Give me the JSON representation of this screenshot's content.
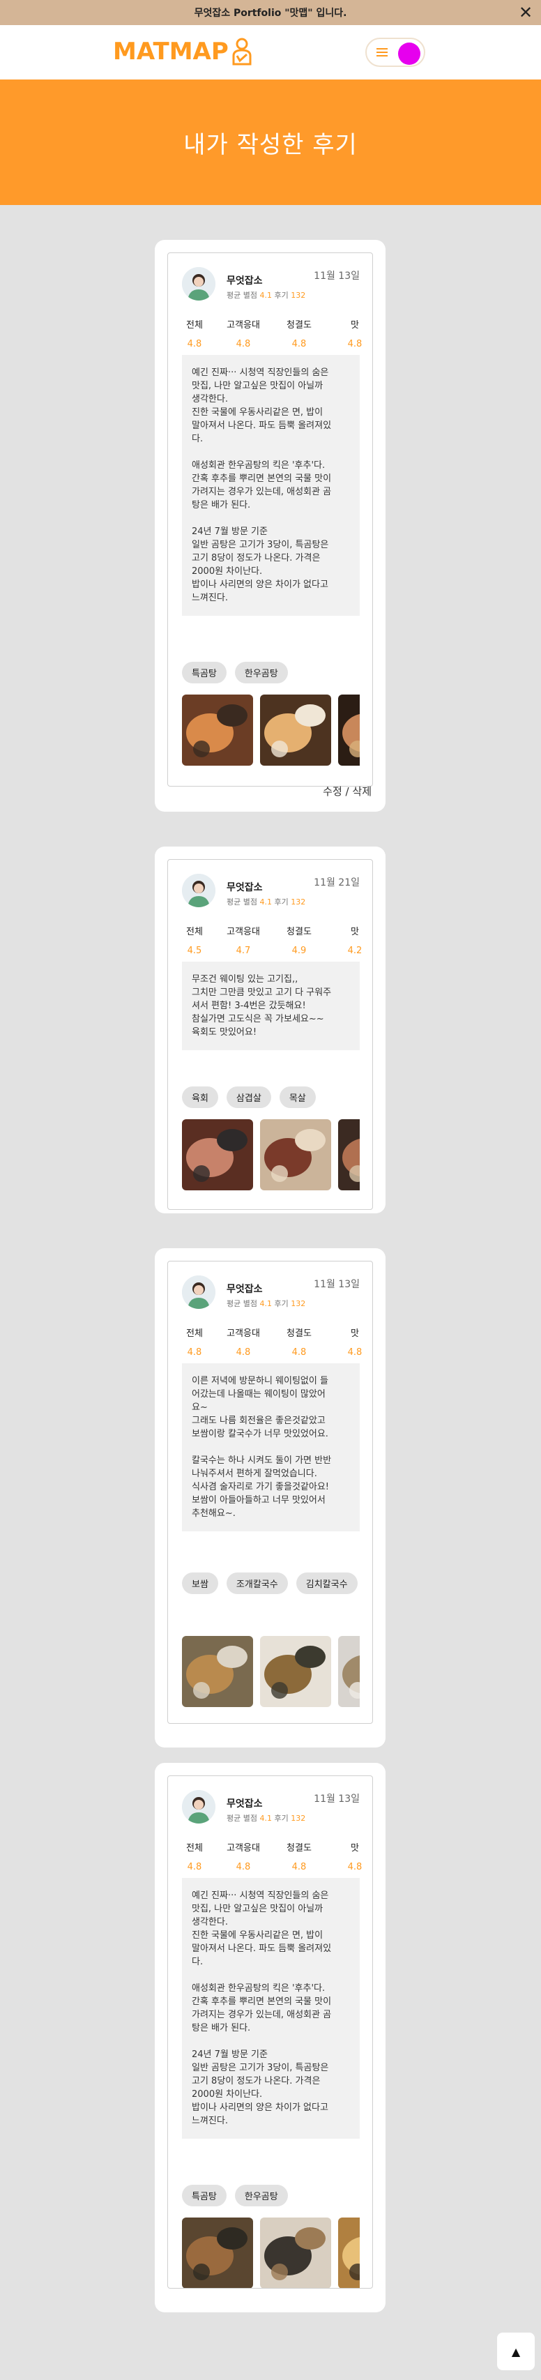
{
  "notice": {
    "text": "무엇잡소 Portfolio \"맛맵\" 입니다.",
    "close": "✕"
  },
  "header": {
    "logo": "MATMAP"
  },
  "banner": {
    "title": "내가 작성한 후기"
  },
  "colors": {
    "accent": "#ff9a1f",
    "banner": "#ff9a2a",
    "avatar": "#e600ee",
    "notice": "#d4b596"
  },
  "score_labels": [
    "전체",
    "고객응대",
    "청결도",
    "맛"
  ],
  "meta_labels": {
    "rating": "평균 별점",
    "reviews": "후기"
  },
  "actions": {
    "edit": "수정",
    "sep": "/",
    "delete": "삭제"
  },
  "reviews": [
    {
      "name": "무엇잡소",
      "rating": "4.1",
      "count": "132",
      "date": "11월 13일",
      "scores": [
        "4.8",
        "4.8",
        "4.8",
        "4.8"
      ],
      "text": "예긴 진짜··· 시청역 직장인들의 숨은\n맛집, 나만 알고싶은 맛집이 아닐까\n생각한다.\n진한 국물에 우동사리같은 면, 밥이\n말아져서 나온다. 파도 듬뿍 올려져있\n다.\n\n애성회관 한우곰탕의 킥은 '후추'다.\n간혹 후추를 뿌리면 본연의 국물 맛이\n가려지는 경우가 있는데, 애성회관 곰\n탕은 배가 된다.\n\n24년 7월 방문 기준\n일반 곰탕은 고기가 3당이, 특곰탕은\n고기 8당이 정도가 나온다. 가격은\n2000원 차이난다.\n밥이나 사리면의 양은 차이가 없다고\n느껴진다.",
      "tags": [
        "특곰탕",
        "한우곰탕"
      ]
    },
    {
      "name": "무엇잡소",
      "rating": "4.1",
      "count": "132",
      "date": "11월 21일",
      "scores": [
        "4.5",
        "4.7",
        "4.9",
        "4.2"
      ],
      "text": "무조건 웨이팅 있는 고기집,,\n그치만 그만큼 맛있고 고기 다 구워주\n셔서 편함! 3-4번은 갔듯해요!\n참실가면 고도식은 꼭 가보세요~~\n육회도 맛있어요!",
      "tags": [
        "육회",
        "삼겹살",
        "목살"
      ]
    },
    {
      "name": "무엇잡소",
      "rating": "4.1",
      "count": "132",
      "date": "11월 13일",
      "scores": [
        "4.8",
        "4.8",
        "4.8",
        "4.8"
      ],
      "text": "이른 저녁에 방문하니 웨이팅없이 들\n어갔는데 나올때는 웨이팅이 많았어\n요~\n그래도 나름 회전율은 좋은것같았고\n보쌈이랑 칼국수가 너무 맛있었어요.\n\n칼국수는 하나 시켜도 둘이 가면 반반\n나눠주셔서 편하게 잘먹었습니다.\n식사겸 술자리로 가기 좋을것같아요!\n보쌈이 아들아들하고 너무 맛있어서\n추천해요~.",
      "tags": [
        "보쌈",
        "조개칼국수",
        "김치칼국수"
      ]
    },
    {
      "name": "무엇잡소",
      "rating": "4.1",
      "count": "132",
      "date": "11월 13일",
      "scores": [
        "4.8",
        "4.8",
        "4.8",
        "4.8"
      ],
      "text": "예긴 진짜··· 시청역 직장인들의 숨은\n맛집, 나만 알고싶은 맛집이 아닐까\n생각한다.\n진한 국물에 우동사리같은 면, 밥이\n말아져서 나온다. 파도 듬뿍 올려져있\n다.\n\n애성회관 한우곰탕의 킥은 '후추'다.\n간혹 후추를 뿌리면 본연의 국물 맛이\n가려지는 경우가 있는데, 애성회관 곰\n탕은 배가 된다.\n\n24년 7월 방문 기준\n일반 곰탕은 고기가 3당이, 특곰탕은\n고기 8당이 정도가 나온다. 가격은\n2000원 차이난다.\n밥이나 사리면의 양은 차이가 없다고\n느껴진다.",
      "tags": [
        "특곰탕",
        "한우곰탕"
      ]
    }
  ],
  "scroll_top_icon": "▲"
}
